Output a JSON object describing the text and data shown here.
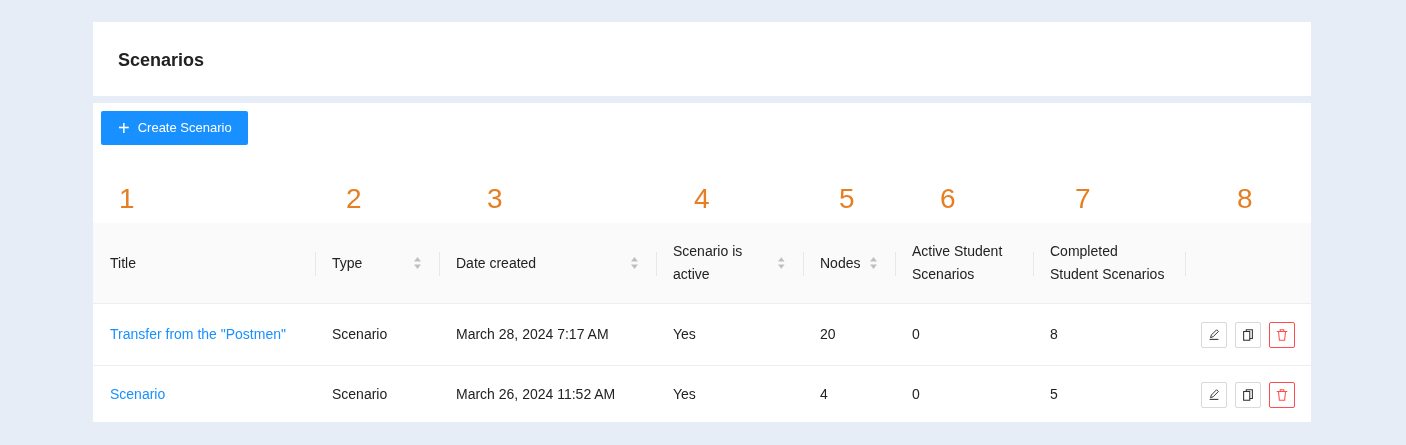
{
  "page_title": "Scenarios",
  "create_button": {
    "label": "Create Scenario",
    "icon": "+"
  },
  "annotations": [
    "1",
    "2",
    "3",
    "4",
    "5",
    "6",
    "7",
    "8"
  ],
  "table": {
    "columns": [
      {
        "label": "Title",
        "sortable": false
      },
      {
        "label": "Type",
        "sortable": true
      },
      {
        "label": "Date created",
        "sortable": true
      },
      {
        "label": "Scenario is active",
        "sortable": true
      },
      {
        "label": "Nodes",
        "sortable": true
      },
      {
        "label": "Active Student Scenarios",
        "sortable": false
      },
      {
        "label": "Completed Student Scenarios",
        "sortable": false
      }
    ],
    "rows": [
      {
        "title": "Transfer from the \"Postmen\"",
        "type": "Scenario",
        "date_created": "March 28, 2024 7:17 AM",
        "active": "Yes",
        "nodes": "20",
        "active_student": "0",
        "completed_student": "8"
      },
      {
        "title": "Scenario",
        "type": "Scenario",
        "date_created": "March 26, 2024 11:52 AM",
        "active": "Yes",
        "nodes": "4",
        "active_student": "0",
        "completed_student": "5"
      }
    ]
  }
}
